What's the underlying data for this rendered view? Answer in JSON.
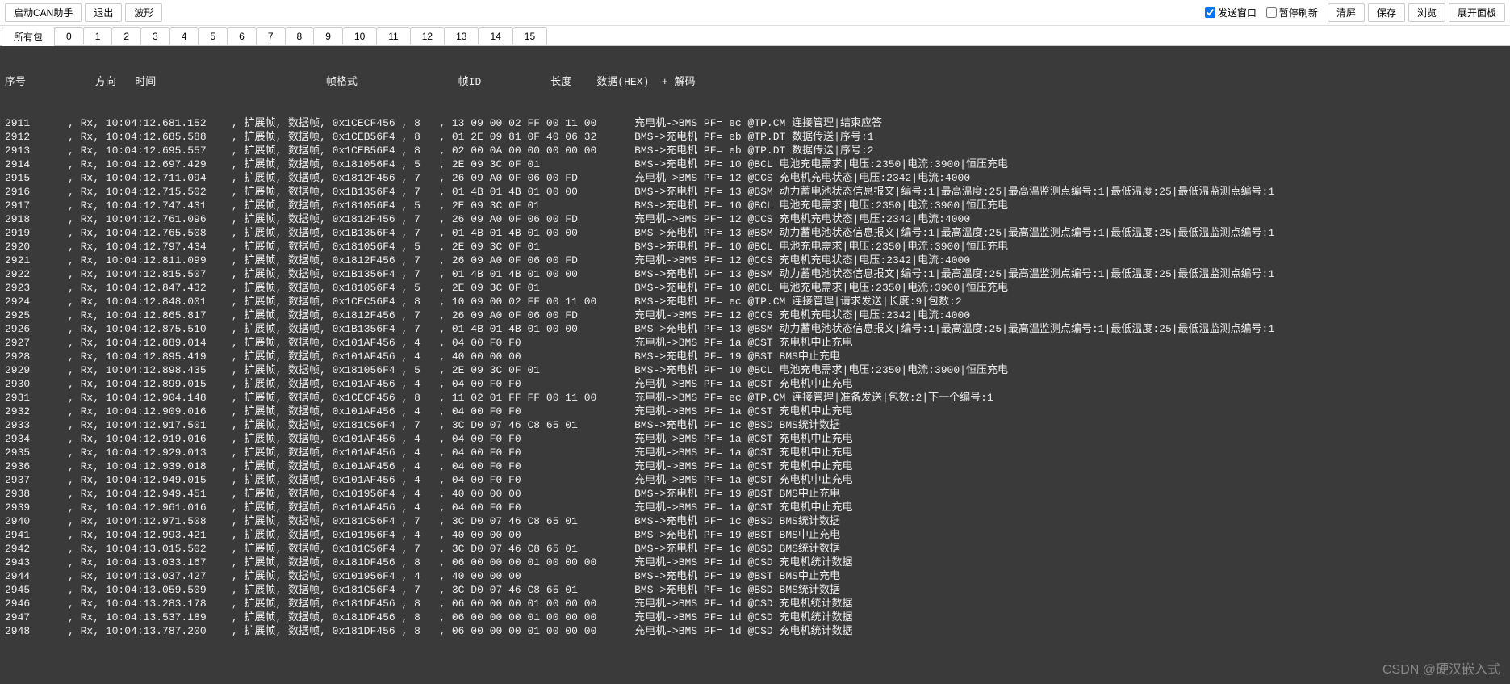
{
  "toolbar": {
    "start_can_label": "启动CAN助手",
    "exit_label": "退出",
    "wave_label": "波形",
    "send_window_label": "发送窗口",
    "send_window_checked": true,
    "pause_refresh_label": "暂停刷新",
    "pause_refresh_checked": false,
    "clear_label": "清屏",
    "save_label": "保存",
    "browse_label": "浏览",
    "expand_panel_label": "展开面板"
  },
  "tabs": {
    "items": [
      "所有包",
      "0",
      "1",
      "2",
      "3",
      "4",
      "5",
      "6",
      "7",
      "8",
      "9",
      "10",
      "11",
      "12",
      "13",
      "14",
      "15"
    ],
    "active": 0
  },
  "log": {
    "header": "序号           方向   时间                           帧格式                帧ID           长度    数据(HEX)  + 解码",
    "rows": [
      {
        "seq": "2911",
        "dir": "Rx",
        "time": "10:04:12.681.152",
        "fmt": "扩展帧",
        "type": "数据帧",
        "id": "0x1CECF456",
        "len": "8",
        "hex": "13 09 00 02 FF 00 11 00",
        "decode": "充电机->BMS PF= ec @TP.CM 连接管理|结束应答"
      },
      {
        "seq": "2912",
        "dir": "Rx",
        "time": "10:04:12.685.588",
        "fmt": "扩展帧",
        "type": "数据帧",
        "id": "0x1CEB56F4",
        "len": "8",
        "hex": "01 2E 09 81 0F 40 06 32",
        "decode": "BMS->充电机 PF= eb @TP.DT 数据传送|序号:1"
      },
      {
        "seq": "2913",
        "dir": "Rx",
        "time": "10:04:12.695.557",
        "fmt": "扩展帧",
        "type": "数据帧",
        "id": "0x1CEB56F4",
        "len": "8",
        "hex": "02 00 0A 00 00 00 00 00",
        "decode": "BMS->充电机 PF= eb @TP.DT 数据传送|序号:2"
      },
      {
        "seq": "2914",
        "dir": "Rx",
        "time": "10:04:12.697.429",
        "fmt": "扩展帧",
        "type": "数据帧",
        "id": "0x181056F4",
        "len": "5",
        "hex": "2E 09 3C 0F 01",
        "decode": "BMS->充电机 PF= 10 @BCL 电池充电需求|电压:2350|电流:3900|恒压充电"
      },
      {
        "seq": "2915",
        "dir": "Rx",
        "time": "10:04:12.711.094",
        "fmt": "扩展帧",
        "type": "数据帧",
        "id": "0x1812F456",
        "len": "7",
        "hex": "26 09 A0 0F 06 00 FD",
        "decode": "充电机->BMS PF= 12 @CCS 充电机充电状态|电压:2342|电流:4000"
      },
      {
        "seq": "2916",
        "dir": "Rx",
        "time": "10:04:12.715.502",
        "fmt": "扩展帧",
        "type": "数据帧",
        "id": "0x1B1356F4",
        "len": "7",
        "hex": "01 4B 01 4B 01 00 00",
        "decode": "BMS->充电机 PF= 13 @BSM 动力蓄电池状态信息报文|编号:1|最高温度:25|最高温监测点编号:1|最低温度:25|最低温监测点编号:1"
      },
      {
        "seq": "2917",
        "dir": "Rx",
        "time": "10:04:12.747.431",
        "fmt": "扩展帧",
        "type": "数据帧",
        "id": "0x181056F4",
        "len": "5",
        "hex": "2E 09 3C 0F 01",
        "decode": "BMS->充电机 PF= 10 @BCL 电池充电需求|电压:2350|电流:3900|恒压充电"
      },
      {
        "seq": "2918",
        "dir": "Rx",
        "time": "10:04:12.761.096",
        "fmt": "扩展帧",
        "type": "数据帧",
        "id": "0x1812F456",
        "len": "7",
        "hex": "26 09 A0 0F 06 00 FD",
        "decode": "充电机->BMS PF= 12 @CCS 充电机充电状态|电压:2342|电流:4000"
      },
      {
        "seq": "2919",
        "dir": "Rx",
        "time": "10:04:12.765.508",
        "fmt": "扩展帧",
        "type": "数据帧",
        "id": "0x1B1356F4",
        "len": "7",
        "hex": "01 4B 01 4B 01 00 00",
        "decode": "BMS->充电机 PF= 13 @BSM 动力蓄电池状态信息报文|编号:1|最高温度:25|最高温监测点编号:1|最低温度:25|最低温监测点编号:1"
      },
      {
        "seq": "2920",
        "dir": "Rx",
        "time": "10:04:12.797.434",
        "fmt": "扩展帧",
        "type": "数据帧",
        "id": "0x181056F4",
        "len": "5",
        "hex": "2E 09 3C 0F 01",
        "decode": "BMS->充电机 PF= 10 @BCL 电池充电需求|电压:2350|电流:3900|恒压充电"
      },
      {
        "seq": "2921",
        "dir": "Rx",
        "time": "10:04:12.811.099",
        "fmt": "扩展帧",
        "type": "数据帧",
        "id": "0x1812F456",
        "len": "7",
        "hex": "26 09 A0 0F 06 00 FD",
        "decode": "充电机->BMS PF= 12 @CCS 充电机充电状态|电压:2342|电流:4000"
      },
      {
        "seq": "2922",
        "dir": "Rx",
        "time": "10:04:12.815.507",
        "fmt": "扩展帧",
        "type": "数据帧",
        "id": "0x1B1356F4",
        "len": "7",
        "hex": "01 4B 01 4B 01 00 00",
        "decode": "BMS->充电机 PF= 13 @BSM 动力蓄电池状态信息报文|编号:1|最高温度:25|最高温监测点编号:1|最低温度:25|最低温监测点编号:1"
      },
      {
        "seq": "2923",
        "dir": "Rx",
        "time": "10:04:12.847.432",
        "fmt": "扩展帧",
        "type": "数据帧",
        "id": "0x181056F4",
        "len": "5",
        "hex": "2E 09 3C 0F 01",
        "decode": "BMS->充电机 PF= 10 @BCL 电池充电需求|电压:2350|电流:3900|恒压充电"
      },
      {
        "seq": "2924",
        "dir": "Rx",
        "time": "10:04:12.848.001",
        "fmt": "扩展帧",
        "type": "数据帧",
        "id": "0x1CEC56F4",
        "len": "8",
        "hex": "10 09 00 02 FF 00 11 00",
        "decode": "BMS->充电机 PF= ec @TP.CM 连接管理|请求发送|长度:9|包数:2"
      },
      {
        "seq": "2925",
        "dir": "Rx",
        "time": "10:04:12.865.817",
        "fmt": "扩展帧",
        "type": "数据帧",
        "id": "0x1812F456",
        "len": "7",
        "hex": "26 09 A0 0F 06 00 FD",
        "decode": "充电机->BMS PF= 12 @CCS 充电机充电状态|电压:2342|电流:4000"
      },
      {
        "seq": "2926",
        "dir": "Rx",
        "time": "10:04:12.875.510",
        "fmt": "扩展帧",
        "type": "数据帧",
        "id": "0x1B1356F4",
        "len": "7",
        "hex": "01 4B 01 4B 01 00 00",
        "decode": "BMS->充电机 PF= 13 @BSM 动力蓄电池状态信息报文|编号:1|最高温度:25|最高温监测点编号:1|最低温度:25|最低温监测点编号:1"
      },
      {
        "seq": "2927",
        "dir": "Rx",
        "time": "10:04:12.889.014",
        "fmt": "扩展帧",
        "type": "数据帧",
        "id": "0x101AF456",
        "len": "4",
        "hex": "04 00 F0 F0",
        "decode": "充电机->BMS PF= 1a @CST 充电机中止充电"
      },
      {
        "seq": "2928",
        "dir": "Rx",
        "time": "10:04:12.895.419",
        "fmt": "扩展帧",
        "type": "数据帧",
        "id": "0x101AF456",
        "len": "4",
        "hex": "40 00 00 00",
        "decode": "BMS->充电机 PF= 19 @BST BMS中止充电"
      },
      {
        "seq": "2929",
        "dir": "Rx",
        "time": "10:04:12.898.435",
        "fmt": "扩展帧",
        "type": "数据帧",
        "id": "0x181056F4",
        "len": "5",
        "hex": "2E 09 3C 0F 01",
        "decode": "BMS->充电机 PF= 10 @BCL 电池充电需求|电压:2350|电流:3900|恒压充电"
      },
      {
        "seq": "2930",
        "dir": "Rx",
        "time": "10:04:12.899.015",
        "fmt": "扩展帧",
        "type": "数据帧",
        "id": "0x101AF456",
        "len": "4",
        "hex": "04 00 F0 F0",
        "decode": "充电机->BMS PF= 1a @CST 充电机中止充电"
      },
      {
        "seq": "2931",
        "dir": "Rx",
        "time": "10:04:12.904.148",
        "fmt": "扩展帧",
        "type": "数据帧",
        "id": "0x1CECF456",
        "len": "8",
        "hex": "11 02 01 FF FF 00 11 00",
        "decode": "充电机->BMS PF= ec @TP.CM 连接管理|准备发送|包数:2|下一个编号:1"
      },
      {
        "seq": "2932",
        "dir": "Rx",
        "time": "10:04:12.909.016",
        "fmt": "扩展帧",
        "type": "数据帧",
        "id": "0x101AF456",
        "len": "4",
        "hex": "04 00 F0 F0",
        "decode": "充电机->BMS PF= 1a @CST 充电机中止充电"
      },
      {
        "seq": "2933",
        "dir": "Rx",
        "time": "10:04:12.917.501",
        "fmt": "扩展帧",
        "type": "数据帧",
        "id": "0x181C56F4",
        "len": "7",
        "hex": "3C D0 07 46 C8 65 01",
        "decode": "BMS->充电机 PF= 1c @BSD BMS统计数据"
      },
      {
        "seq": "2934",
        "dir": "Rx",
        "time": "10:04:12.919.016",
        "fmt": "扩展帧",
        "type": "数据帧",
        "id": "0x101AF456",
        "len": "4",
        "hex": "04 00 F0 F0",
        "decode": "充电机->BMS PF= 1a @CST 充电机中止充电"
      },
      {
        "seq": "2935",
        "dir": "Rx",
        "time": "10:04:12.929.013",
        "fmt": "扩展帧",
        "type": "数据帧",
        "id": "0x101AF456",
        "len": "4",
        "hex": "04 00 F0 F0",
        "decode": "充电机->BMS PF= 1a @CST 充电机中止充电"
      },
      {
        "seq": "2936",
        "dir": "Rx",
        "time": "10:04:12.939.018",
        "fmt": "扩展帧",
        "type": "数据帧",
        "id": "0x101AF456",
        "len": "4",
        "hex": "04 00 F0 F0",
        "decode": "充电机->BMS PF= 1a @CST 充电机中止充电"
      },
      {
        "seq": "2937",
        "dir": "Rx",
        "time": "10:04:12.949.015",
        "fmt": "扩展帧",
        "type": "数据帧",
        "id": "0x101AF456",
        "len": "4",
        "hex": "04 00 F0 F0",
        "decode": "充电机->BMS PF= 1a @CST 充电机中止充电"
      },
      {
        "seq": "2938",
        "dir": "Rx",
        "time": "10:04:12.949.451",
        "fmt": "扩展帧",
        "type": "数据帧",
        "id": "0x101956F4",
        "len": "4",
        "hex": "40 00 00 00",
        "decode": "BMS->充电机 PF= 19 @BST BMS中止充电"
      },
      {
        "seq": "2939",
        "dir": "Rx",
        "time": "10:04:12.961.016",
        "fmt": "扩展帧",
        "type": "数据帧",
        "id": "0x101AF456",
        "len": "4",
        "hex": "04 00 F0 F0",
        "decode": "充电机->BMS PF= 1a @CST 充电机中止充电"
      },
      {
        "seq": "2940",
        "dir": "Rx",
        "time": "10:04:12.971.508",
        "fmt": "扩展帧",
        "type": "数据帧",
        "id": "0x181C56F4",
        "len": "7",
        "hex": "3C D0 07 46 C8 65 01",
        "decode": "BMS->充电机 PF= 1c @BSD BMS统计数据"
      },
      {
        "seq": "2941",
        "dir": "Rx",
        "time": "10:04:12.993.421",
        "fmt": "扩展帧",
        "type": "数据帧",
        "id": "0x101956F4",
        "len": "4",
        "hex": "40 00 00 00",
        "decode": "BMS->充电机 PF= 19 @BST BMS中止充电"
      },
      {
        "seq": "2942",
        "dir": "Rx",
        "time": "10:04:13.015.502",
        "fmt": "扩展帧",
        "type": "数据帧",
        "id": "0x181C56F4",
        "len": "7",
        "hex": "3C D0 07 46 C8 65 01",
        "decode": "BMS->充电机 PF= 1c @BSD BMS统计数据"
      },
      {
        "seq": "2943",
        "dir": "Rx",
        "time": "10:04:13.033.167",
        "fmt": "扩展帧",
        "type": "数据帧",
        "id": "0x181DF456",
        "len": "8",
        "hex": "06 00 00 00 01 00 00 00",
        "decode": "充电机->BMS PF= 1d @CSD 充电机统计数据"
      },
      {
        "seq": "2944",
        "dir": "Rx",
        "time": "10:04:13.037.427",
        "fmt": "扩展帧",
        "type": "数据帧",
        "id": "0x101956F4",
        "len": "4",
        "hex": "40 00 00 00",
        "decode": "BMS->充电机 PF= 19 @BST BMS中止充电"
      },
      {
        "seq": "2945",
        "dir": "Rx",
        "time": "10:04:13.059.509",
        "fmt": "扩展帧",
        "type": "数据帧",
        "id": "0x181C56F4",
        "len": "7",
        "hex": "3C D0 07 46 C8 65 01",
        "decode": "BMS->充电机 PF= 1c @BSD BMS统计数据"
      },
      {
        "seq": "2946",
        "dir": "Rx",
        "time": "10:04:13.283.178",
        "fmt": "扩展帧",
        "type": "数据帧",
        "id": "0x181DF456",
        "len": "8",
        "hex": "06 00 00 00 01 00 00 00",
        "decode": "充电机->BMS PF= 1d @CSD 充电机统计数据"
      },
      {
        "seq": "2947",
        "dir": "Rx",
        "time": "10:04:13.537.189",
        "fmt": "扩展帧",
        "type": "数据帧",
        "id": "0x181DF456",
        "len": "8",
        "hex": "06 00 00 00 01 00 00 00",
        "decode": "充电机->BMS PF= 1d @CSD 充电机统计数据"
      },
      {
        "seq": "2948",
        "dir": "Rx",
        "time": "10:04:13.787.200",
        "fmt": "扩展帧",
        "type": "数据帧",
        "id": "0x181DF456",
        "len": "8",
        "hex": "06 00 00 00 01 00 00 00",
        "decode": "充电机->BMS PF= 1d @CSD 充电机统计数据"
      }
    ]
  },
  "watermark": "CSDN @硬汉嵌入式"
}
